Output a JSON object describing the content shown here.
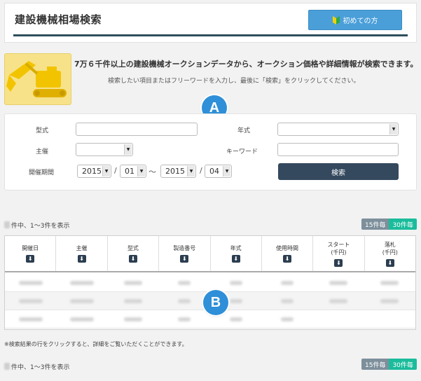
{
  "header": {
    "title": "建設機械相場検索",
    "first_time_button": "初めての方"
  },
  "hero": {
    "main_text": "7万６千件以上の建設機械オークションデータから、オークション価格や詳細情報が検索できます。",
    "sub_text": "検索したい項目またはフリーワードを入力し、最後に「検索」をクリックしてください。"
  },
  "badges": {
    "a": "A",
    "b": "B"
  },
  "search": {
    "model_label": "型式",
    "year_label": "年式",
    "organizer_label": "主催",
    "keyword_label": "キーワード",
    "period_label": "開催期間",
    "from_year": "2015",
    "from_month": "01",
    "to_year": "2015",
    "to_month": "04",
    "slash": "/",
    "tilde": "～",
    "search_button": "検索"
  },
  "results": {
    "count_text": "件中、1～3件を表示",
    "per_page_15": "15件毎",
    "per_page_30": "30件毎",
    "columns": [
      "開催日",
      "主催",
      "型式",
      "製造番号",
      "年式",
      "使用時間",
      "スタート\n(千円)",
      "落札\n(千円)"
    ],
    "sort_icon": "arrow-down-icon"
  },
  "note": "※検索結果の行をクリックすると、詳細をご覧いただくことができます。",
  "colors": {
    "accent_blue": "#4a9fd9",
    "dark_navy": "#34495e",
    "teal": "#1abc9c",
    "slate": "#7d8f9b",
    "badge_blue": "#2f8fd8"
  }
}
